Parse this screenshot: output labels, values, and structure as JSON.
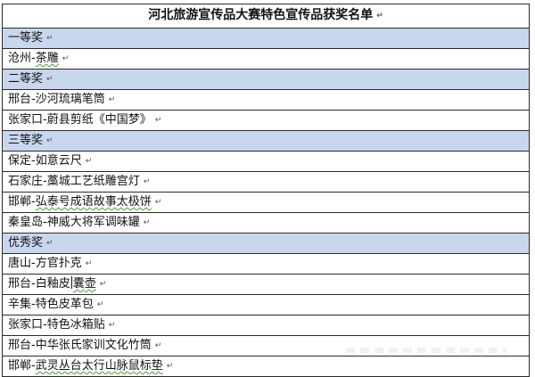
{
  "title": "河北旅游宣传品大赛特色宣传品获奖名单",
  "paragraph_mark": "↵",
  "sections": [
    {
      "heading": "一等奖",
      "entries": [
        {
          "parts": [
            "沧州-",
            "茶雕"
          ],
          "squiggle": [
            false,
            true
          ]
        }
      ]
    },
    {
      "heading": "二等奖",
      "entries": [
        {
          "parts": [
            "邢台-沙河琉璃笔筒"
          ],
          "squiggle": [
            false
          ]
        },
        {
          "parts": [
            "张家口-蔚县剪纸《中国梦》"
          ],
          "squiggle": [
            false
          ]
        }
      ]
    },
    {
      "heading": "三等奖",
      "entries": [
        {
          "parts": [
            "保定-如意云尺"
          ],
          "squiggle": [
            false
          ]
        },
        {
          "parts": [
            "石家庄-藁城工艺纸雕宫灯"
          ],
          "squiggle": [
            false
          ]
        },
        {
          "parts": [
            "邯郸-",
            "弘泰号成语故事太极饼"
          ],
          "squiggle": [
            false,
            true
          ]
        },
        {
          "parts": [
            "秦皇岛-神威大将军调味罐"
          ],
          "squiggle": [
            false
          ]
        }
      ]
    },
    {
      "heading": "优秀奖",
      "entries": [
        {
          "parts": [
            "唐山-方官扑克"
          ],
          "squiggle": [
            false
          ]
        },
        {
          "parts": [
            "邢台-白釉皮",
            "囊",
            "壶"
          ],
          "squiggle": [
            false,
            true,
            true
          ],
          "caret_after": 0
        },
        {
          "parts": [
            "辛集-特色皮革包"
          ],
          "squiggle": [
            false
          ]
        },
        {
          "parts": [
            "张家口-特色冰箱贴"
          ],
          "squiggle": [
            false
          ]
        },
        {
          "parts": [
            "邢台-中华张氏家训文化竹筒"
          ],
          "squiggle": [
            false
          ]
        },
        {
          "parts": [
            "邯郸-",
            "武灵丛台太行山脉鼠标垫"
          ],
          "squiggle": [
            false,
            true
          ]
        }
      ]
    }
  ]
}
